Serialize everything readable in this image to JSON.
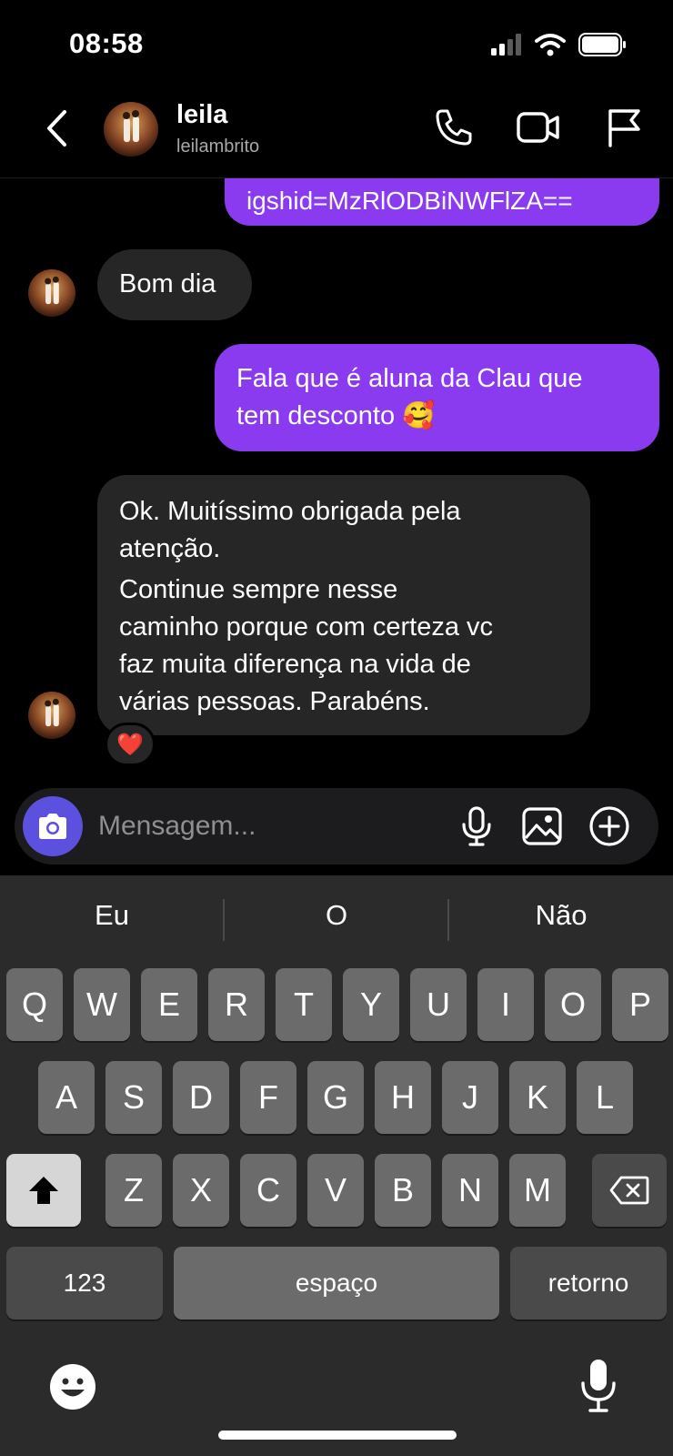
{
  "status_bar": {
    "time": "08:58",
    "signal_icon": "cellular-signal-icon",
    "wifi_icon": "wifi-icon",
    "battery_icon": "battery-icon"
  },
  "header": {
    "back_icon": "chevron-left-icon",
    "name": "leila",
    "username": "leilambrito",
    "call_icon": "phone-icon",
    "video_icon": "video-camera-icon",
    "report_icon": "flag-icon"
  },
  "messages": [
    {
      "direction": "outgoing",
      "text": "igshid=MzRlODBiNWFlZA=="
    },
    {
      "direction": "incoming",
      "text": "Bom dia"
    },
    {
      "direction": "outgoing",
      "lines": [
        "Fala que é aluna da Clau que",
        "tem desconto 🥰"
      ]
    },
    {
      "direction": "incoming",
      "lines": [
        "Ok. Muitíssimo obrigada pela",
        "atenção.",
        "Continue sempre nesse",
        "caminho porque com certeza vc",
        "faz muita diferença na vida de",
        "várias pessoas. Parabéns."
      ],
      "reaction": "❤️"
    }
  ],
  "composer": {
    "placeholder": "Mensagem...",
    "camera_icon": "camera-icon",
    "mic_icon": "microphone-icon",
    "gallery_icon": "image-icon",
    "more_icon": "plus-circle-icon"
  },
  "keyboard": {
    "suggestions": [
      "Eu",
      "O",
      "Não"
    ],
    "row1": [
      "Q",
      "W",
      "E",
      "R",
      "T",
      "Y",
      "U",
      "I",
      "O",
      "P"
    ],
    "row2": [
      "A",
      "S",
      "D",
      "F",
      "G",
      "H",
      "J",
      "K",
      "L"
    ],
    "row3": [
      "Z",
      "X",
      "C",
      "V",
      "B",
      "N",
      "M"
    ],
    "numbers_label": "123",
    "space_label": "espaço",
    "return_label": "retorno",
    "emoji_icon": "emoji-icon",
    "dictation_icon": "microphone-icon",
    "shift_icon": "shift-icon",
    "delete_icon": "backspace-icon"
  },
  "colors": {
    "outgoing_bubble": "#8a3bf0",
    "incoming_bubble": "#262626",
    "camera_button": "#5b51de"
  }
}
